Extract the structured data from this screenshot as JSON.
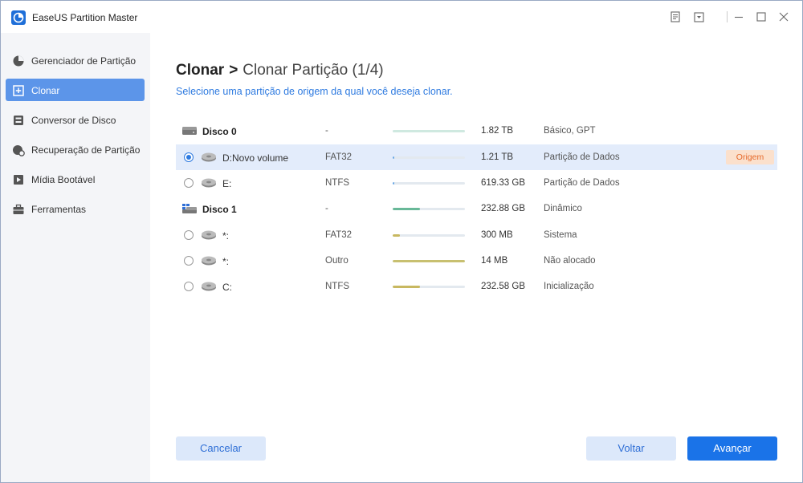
{
  "app": {
    "title": "EaseUS Partition Master"
  },
  "sidebar": {
    "items": [
      {
        "label": "Gerenciador de Partição",
        "icon": "pie-chart-icon",
        "active": false
      },
      {
        "label": "Clonar",
        "icon": "clone-icon",
        "active": true
      },
      {
        "label": "Conversor de Disco",
        "icon": "disk-convert-icon",
        "active": false
      },
      {
        "label": "Recuperação de Partição",
        "icon": "recovery-icon",
        "active": false
      },
      {
        "label": "Mídia Bootável",
        "icon": "bootable-media-icon",
        "active": false
      },
      {
        "label": "Ferramentas",
        "icon": "toolbox-icon",
        "active": false
      }
    ]
  },
  "main": {
    "breadcrumb_root": "Clonar",
    "breadcrumb_sep": ">",
    "breadcrumb_step": "Clonar Partição (1/4)",
    "subtitle": "Selecione uma partição de origem da qual você deseja clonar.",
    "rows": [
      {
        "kind": "disk",
        "name": "Disco 0",
        "fs": "-",
        "usage": 1.0,
        "bar_color": "#cfe9e0",
        "size": "1.82 TB",
        "type": "Básico, GPT"
      },
      {
        "kind": "partition",
        "name": "D:Novo volume",
        "fs": "FAT32",
        "usage": 0.01,
        "bar_color": "#6aa8e6",
        "size": "1.21 TB",
        "type": "Partição de Dados",
        "selected": true,
        "badge": "Origem"
      },
      {
        "kind": "partition",
        "name": "E:",
        "fs": "NTFS",
        "usage": 0.02,
        "bar_color": "#6aa8e6",
        "size": "619.33 GB",
        "type": "Partição de Dados"
      },
      {
        "kind": "disk",
        "name": "Disco 1",
        "fs": "-",
        "usage": 0.38,
        "bar_color": "#68b898",
        "size": "232.88 GB",
        "type": "Dinâmico"
      },
      {
        "kind": "partition",
        "name": "*:",
        "fs": "FAT32",
        "usage": 0.1,
        "bar_color": "#c8b860",
        "size": "300 MB",
        "type": "Sistema"
      },
      {
        "kind": "partition",
        "name": "*:",
        "fs": "Outro",
        "usage": 1.0,
        "bar_color": "#c8c070",
        "size": "14 MB",
        "type": "Não alocado"
      },
      {
        "kind": "partition",
        "name": "C:",
        "fs": "NTFS",
        "usage": 0.38,
        "bar_color": "#c8b860",
        "size": "232.58 GB",
        "type": "Inicialização"
      }
    ]
  },
  "buttons": {
    "cancel": "Cancelar",
    "back": "Voltar",
    "next": "Avançar"
  },
  "colors": {
    "accent": "#1a73e8",
    "sidebar_active": "#5c95e9",
    "selected_row": "#e3ecfb",
    "badge_bg": "#fbe0cc",
    "badge_text": "#e66a2c"
  }
}
